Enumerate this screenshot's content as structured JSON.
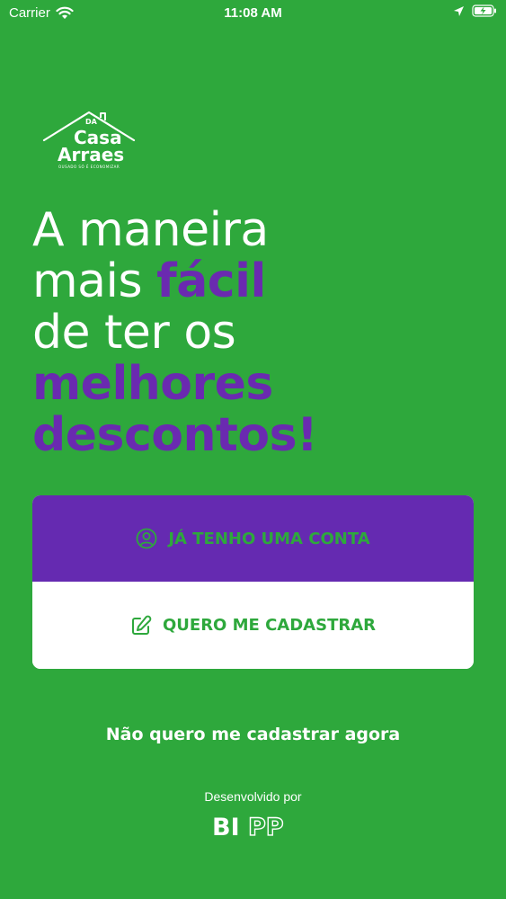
{
  "status_bar": {
    "carrier": "Carrier",
    "time": "11:08 AM",
    "icons": [
      "wifi-icon",
      "location-arrow-icon",
      "battery-charging-icon"
    ]
  },
  "logo": {
    "line1": "Casa",
    "line2": "Arraes",
    "badge": "DA",
    "tagline": "OUSADO SÓ É ECONOMIZAR"
  },
  "headline": {
    "line1": "A maneira",
    "line2_light": "mais ",
    "line2_accent": "fácil",
    "line3": "de ter os",
    "line4": "melhores",
    "line5": "descontos!"
  },
  "buttons": {
    "login_label": "JÁ TENHO UMA CONTA",
    "login_icon": "user-circle-icon",
    "signup_label": "QUERO ME CADASTRAR",
    "signup_icon": "edit-icon"
  },
  "skip_label": "Não quero me cadastrar agora",
  "footer": {
    "developed_by": "Desenvolvido por",
    "brand": "BIPP"
  },
  "colors": {
    "background": "#2ea83c",
    "accent_purple": "#652ab1",
    "white": "#ffffff"
  }
}
